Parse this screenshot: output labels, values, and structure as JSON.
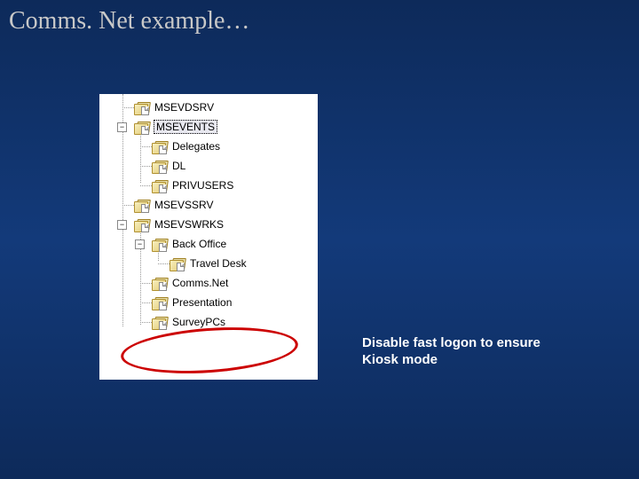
{
  "title": "Comms. Net example…",
  "annotation": "Disable fast logon to ensure Kiosk mode",
  "tree": {
    "n0": "MSEVDSRV",
    "n1": "MSEVENTS",
    "n2": "Delegates",
    "n3": "DL",
    "n4": "PRIVUSERS",
    "n5": "MSEVSSRV",
    "n6": "MSEVSWRKS",
    "n7": "Back Office",
    "n8": "Travel Desk",
    "n9": "Comms.Net",
    "n10": "Presentation",
    "n11": "SurveyPCs"
  },
  "expander_minus": "−"
}
